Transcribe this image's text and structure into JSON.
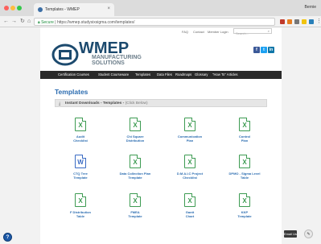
{
  "browser": {
    "tab_title": "Templates - WMEP",
    "user_name": "Bernie",
    "secure_label": "Secure",
    "url": "https://wmep.studysixsigma.com/templates/"
  },
  "utility_nav": {
    "faq": "FAQ",
    "contact": "Contact",
    "member_login": "Member Login",
    "search_placeholder": "Search..."
  },
  "logo": {
    "name": "WMEP",
    "line1": "MANUFACTURING",
    "line2": "SOLUTIONS"
  },
  "main_nav": [
    "Certification Courses",
    "Student Courseware",
    "Templates",
    "Data Files",
    "Roadmaps",
    "Glossary",
    "\"How To\" Articles"
  ],
  "page_title": "Templates",
  "section": {
    "title": "Instant Downloads - Templates -",
    "suffix": "(Click Below)"
  },
  "templates": [
    {
      "line1": "Audit",
      "line2": "Checklist",
      "type": "excel"
    },
    {
      "line1": "Chi Square",
      "line2": "Distribution",
      "type": "excel"
    },
    {
      "line1": "Communication",
      "line2": "Plan",
      "type": "excel"
    },
    {
      "line1": "Control",
      "line2": "Plan",
      "type": "excel"
    },
    {
      "line1": "CTQ Tree",
      "line2": "Template",
      "type": "word"
    },
    {
      "line1": "Data Collection Plan",
      "line2": "Template",
      "type": "excel"
    },
    {
      "line1": "D.M.A.I.C Project",
      "line2": "Checklist",
      "type": "excel"
    },
    {
      "line1": "DPMO - Sigma Level",
      "line2": "Table",
      "type": "excel"
    },
    {
      "line1": "F Distribution",
      "line2": "Table",
      "type": "excel"
    },
    {
      "line1": "FMEA",
      "line2": "Template",
      "type": "excel"
    },
    {
      "line1": "Gantt",
      "line2": "Chart",
      "type": "excel"
    },
    {
      "line1": "KKP",
      "line2": "Template",
      "type": "excel"
    }
  ],
  "floating": {
    "chat_label": "Email Us"
  },
  "colors": {
    "brand_blue": "#1c4a6e",
    "link_blue": "#2b6cb0",
    "excel_green": "#3d9b52",
    "word_blue": "#3a6bc4",
    "nav_dark": "#2a2a2a"
  }
}
